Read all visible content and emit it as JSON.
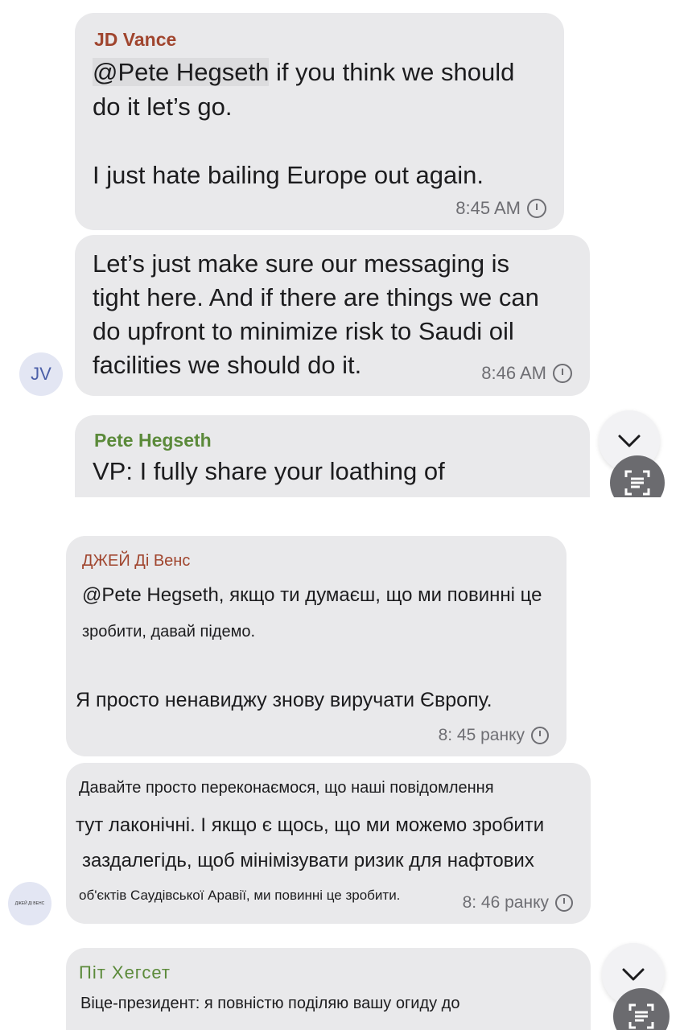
{
  "top": {
    "message1": {
      "sender": "JD Vance",
      "mention": "@Pete Hegseth",
      "line1_rest": " if you think we should",
      "line2": "do it let’s go.",
      "line3": "I just hate bailing Europe out again.",
      "time": "8:45 AM"
    },
    "message2": {
      "line1": "Let’s just make sure our messaging is",
      "line2": "tight here. And if there are things we can",
      "line3": "do upfront to minimize risk to Saudi oil",
      "line4": "facilities we should do it.",
      "time": "8:46 AM"
    },
    "avatar_initials": "JV",
    "message3": {
      "sender": "Pete Hegseth",
      "line1": "VP: I fully share your loathing of"
    }
  },
  "bottom": {
    "message1": {
      "sender": "ДЖЕЙ Ді Венс",
      "line1": "@Pete Hegseth, якщо ти думаєш, що ми повинні це",
      "line2": "зробити, давай підемо.",
      "line3": "Я просто ненавиджу знову виручати Європу.",
      "time": "8: 45 ранку"
    },
    "message2": {
      "line1": "Давайте просто переконаємося, що наші повідомлення",
      "line2": "тут лаконічні. І якщо є щось, що ми можемо зробити",
      "line3": "заздалегідь, щоб мінімізувати ризик для нафтових",
      "line4": "об'єктів Саудівської Аравії, ми повинні це зробити.",
      "time": "8: 46 ранку"
    },
    "avatar_initials": "ДЖЕЙ ДІ ВЕНС",
    "message3": {
      "sender": "Піт Хегсет",
      "line1": "Віце-президент: я повністю поділяю вашу огиду до"
    }
  },
  "colors": {
    "bubble": "#e9e9eb",
    "sender_vance": "#a0452e",
    "sender_hegseth": "#5b8a3a"
  },
  "icons": [
    "clock-icon",
    "chevron-down-icon",
    "scan-text-icon"
  ]
}
